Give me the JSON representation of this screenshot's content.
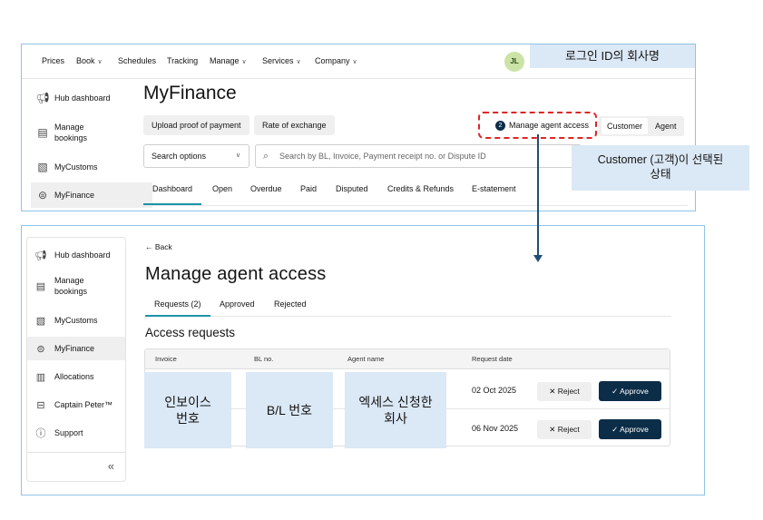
{
  "top": {
    "nav": [
      {
        "label": "Prices"
      },
      {
        "label": "Book",
        "dropdown": true
      },
      {
        "label": "Schedules"
      },
      {
        "label": "Tracking"
      },
      {
        "label": "Manage",
        "dropdown": true
      },
      {
        "label": "Services",
        "dropdown": true
      },
      {
        "label": "Company",
        "dropdown": true
      }
    ],
    "avatar_initials": "JL",
    "annotation_user": "로그인 ID의 회사명",
    "sidebar": [
      {
        "label": "Hub dashboard",
        "icon": "megaphone-icon"
      },
      {
        "label": "Manage bookings",
        "icon": "clipboard-icon"
      },
      {
        "label": "MyCustoms",
        "icon": "customs-doc-icon"
      },
      {
        "label": "MyFinance",
        "icon": "dollar-circle-icon",
        "active": true
      }
    ],
    "page_title": "MyFinance",
    "upload_label": "Upload proof of payment",
    "rate_label": "Rate of exchange",
    "manage_count": "2",
    "manage_label": "Manage agent access",
    "toggle": {
      "customer": "Customer",
      "agent": "Agent",
      "selected": "Customer"
    },
    "search_options": "Search options",
    "search_placeholder": "Search by BL, Invoice, Payment receipt no. or Dispute ID",
    "tabs": [
      "Dashboard",
      "Open",
      "Overdue",
      "Paid",
      "Disputed",
      "Credits & Refunds",
      "E-statement"
    ],
    "annotation_customer_line1": "Customer (고객)이 선택된",
    "annotation_customer_line2": "상태"
  },
  "bottom": {
    "sidebar": [
      {
        "label": "Hub dashboard",
        "icon": "megaphone-icon"
      },
      {
        "label": "Manage bookings",
        "icon": "clipboard-icon"
      },
      {
        "label": "MyCustoms",
        "icon": "customs-doc-icon"
      },
      {
        "label": "MyFinance",
        "icon": "dollar-circle-icon",
        "active": true
      },
      {
        "label": "Allocations",
        "icon": "bar-chart-icon"
      },
      {
        "label": "Captain Peter™",
        "icon": "container-icon"
      },
      {
        "label": "Support",
        "icon": "info-icon"
      }
    ],
    "collapse_symbol": "«",
    "back_label": "← Back",
    "page_title": "Manage agent access",
    "tabs": [
      "Requests (2)",
      "Approved",
      "Rejected"
    ],
    "section_title": "Access requests",
    "table": {
      "headers": [
        "Invoice",
        "BL no.",
        "Agent name",
        "Request date"
      ],
      "rows": [
        {
          "date": "02 Oct 2025",
          "reject": "Reject",
          "approve": "Approve"
        },
        {
          "date": "06 Nov 2025",
          "reject": "Reject",
          "approve": "Approve"
        }
      ]
    },
    "mask_invoice_line1": "인보이스",
    "mask_invoice_line2": "번호",
    "mask_bl": "B/L 번호",
    "mask_agent_line1": "엑세스 신청한",
    "mask_agent_line2": "회사"
  },
  "colors": {
    "accent_teal": "#1a93a8",
    "primary_navy": "#0c2d48",
    "annotation_bg": "#dbe8f5",
    "highlight_red": "#e02424",
    "panel_border": "#8fc3e6"
  }
}
